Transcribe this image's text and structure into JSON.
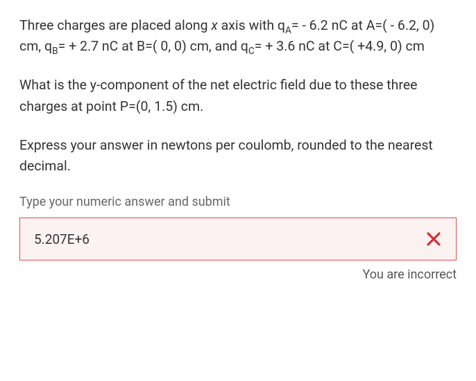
{
  "problem": {
    "para1_parts": {
      "t1": "Three charges are placed along ",
      "x": "x",
      "t2": " axis with q",
      "subA": "A",
      "t3": "= - 6.2 nC at A=( - 6.2, 0) cm,  q",
      "subB": "B",
      "t4": "= + 2.7 nC at B=( 0, 0) cm, and  q",
      "subC": "C",
      "t5": "= + 3.6 nC at C=( +4.9, 0) cm"
    },
    "para2": "What is the y-component of the net electric field due to these three charges at point P=(0, 1.5) cm.",
    "para3": "Express your answer in newtons per coulomb, rounded to the nearest decimal."
  },
  "prompt": "Type your numeric answer and submit",
  "answer": {
    "value": "5.207E+6",
    "feedback": "You are incorrect",
    "status": "incorrect"
  }
}
